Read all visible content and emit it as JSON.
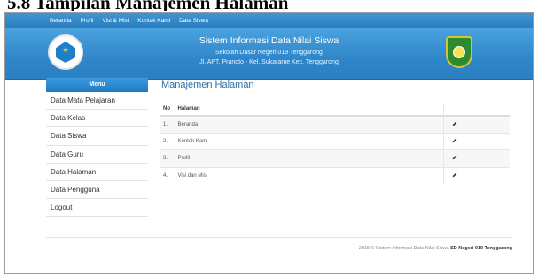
{
  "caption": "5.8   Tampilan Manajemen Halaman",
  "topnav": {
    "items": [
      "Beranda",
      "Profil",
      "Visi & Misi",
      "Kontak Kami",
      "Data Siswa"
    ]
  },
  "banner": {
    "title": "Sistem Informasi Data Nilai Siswa",
    "school": "Sekolah Dasar Negeri 019 Tenggarong",
    "address": "Jl. APT. Pranoto - Kel. Sukarame Kec. Tenggarong"
  },
  "sidebar": {
    "heading": "Menu",
    "items": [
      "Data Mata Pelajaran",
      "Data Kelas",
      "Data Siswa",
      "Data Guru",
      "Data Halaman",
      "Data Pengguna",
      "Logout"
    ]
  },
  "main": {
    "title": "Manajemen Halaman",
    "table": {
      "headers": [
        "No",
        "Halaman",
        ""
      ],
      "rows": [
        {
          "no": "1.",
          "page": "Beranda"
        },
        {
          "no": "2.",
          "page": "Kontak Kami"
        },
        {
          "no": "3.",
          "page": "Profil"
        },
        {
          "no": "4.",
          "page": "Visi dan Misi"
        }
      ]
    }
  },
  "footer": {
    "text": "2015 © Sistem Informasi Data Nilai Siswa",
    "school": "SD Negeri 019 Tenggarong"
  },
  "colors": {
    "accent": "#2f86c9",
    "title": "#2f6ea8"
  },
  "icons": {
    "edit": "pencil-icon",
    "logo_left": "tut-wuri-handayani-logo",
    "logo_right": "kutai-kartanegara-emblem"
  }
}
